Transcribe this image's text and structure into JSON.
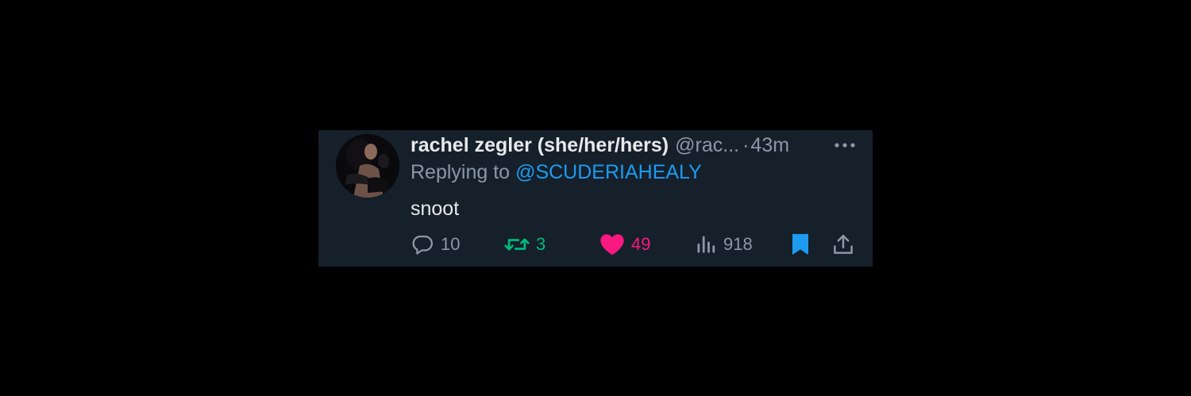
{
  "tweet": {
    "display_name": "rachel zegler (she/her/hers)",
    "handle": "@rac...",
    "separator": "·",
    "time": "43m",
    "reply_prefix": "Replying to",
    "reply_to": "@SCUDERIAHEALY",
    "text": "snoot"
  },
  "actions": {
    "replies": "10",
    "retweets": "3",
    "likes": "49",
    "views": "918"
  },
  "icons": {
    "more": "more-horizontal-icon",
    "reply": "reply-bubble-icon",
    "retweet": "retweet-icon",
    "like": "heart-icon",
    "views": "bar-chart-icon",
    "bookmark": "bookmark-icon",
    "share": "share-icon"
  },
  "colors": {
    "page_background": "#000000",
    "card_background": "#15202b",
    "primary_text": "#e7e9ea",
    "secondary_text": "#8b98a5",
    "link": "#1d9bf0",
    "retweet_active": "#00ba7c",
    "like_active": "#f91880",
    "bookmark_active": "#1d9bf0"
  },
  "state": {
    "retweeted": true,
    "liked": true,
    "bookmarked": true
  }
}
